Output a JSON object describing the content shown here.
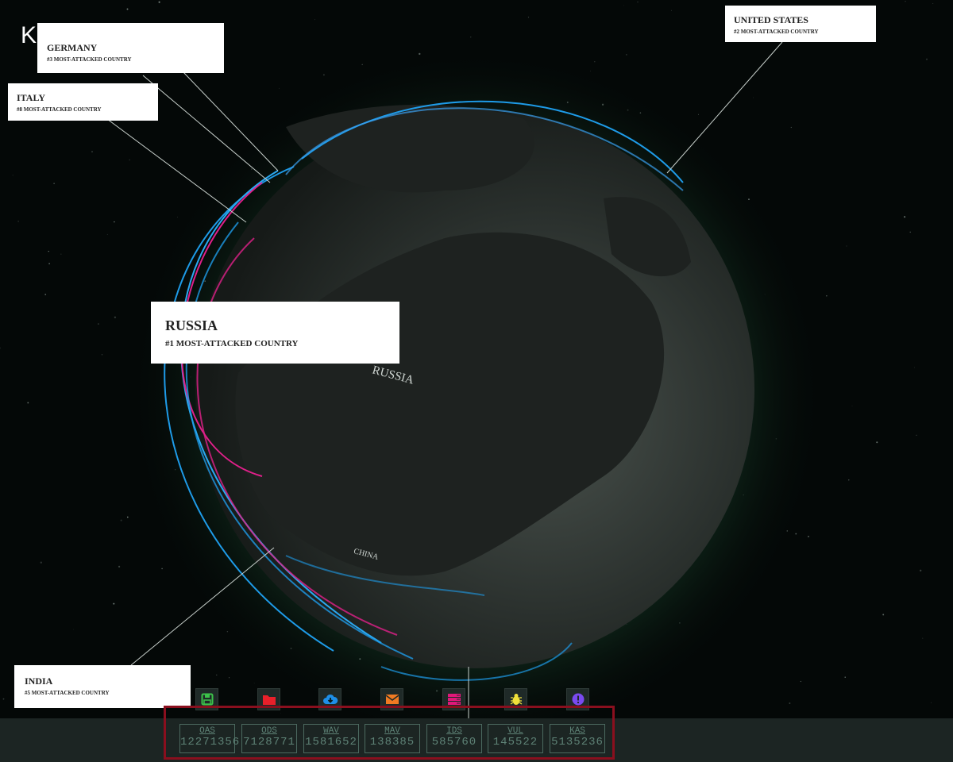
{
  "logo": "KA",
  "callouts": {
    "united_states": {
      "name": "UNITED STATES",
      "rank": "#2 MOST-ATTACKED COUNTRY"
    },
    "germany": {
      "name": "GERMANY",
      "rank": "#3 MOST-ATTACKED COUNTRY"
    },
    "italy": {
      "name": "ITALY",
      "rank": "#8 MOST-ATTACKED COUNTRY"
    },
    "russia": {
      "name": "RUSSIA",
      "rank": "#1 MOST-ATTACKED COUNTRY"
    },
    "india": {
      "name": "INDIA",
      "rank": "#5 MOST-ATTACKED COUNTRY"
    }
  },
  "map_labels": {
    "russia": "RUSSIA",
    "china": "CHINA"
  },
  "toolbar_icons": [
    {
      "icon": "floppy-disk-icon",
      "color": "#3cc24a"
    },
    {
      "icon": "folder-icon",
      "color": "#e8202a"
    },
    {
      "icon": "cloud-download-icon",
      "color": "#1e8fe8"
    },
    {
      "icon": "envelope-icon",
      "color": "#f07a22"
    },
    {
      "icon": "server-icon",
      "color": "#e0187a"
    },
    {
      "icon": "bug-icon",
      "color": "#f0e03a"
    },
    {
      "icon": "exclamation-circle-icon",
      "color": "#7a4af0"
    }
  ],
  "stats": [
    {
      "label": "OAS",
      "value": "12271356"
    },
    {
      "label": "ODS",
      "value": "7128771"
    },
    {
      "label": "WAV",
      "value": "1581652"
    },
    {
      "label": "MAV",
      "value": "138385"
    },
    {
      "label": "IDS",
      "value": "585760"
    },
    {
      "label": "VUL",
      "value": "145522"
    },
    {
      "label": "KAS",
      "value": "5135236"
    }
  ]
}
